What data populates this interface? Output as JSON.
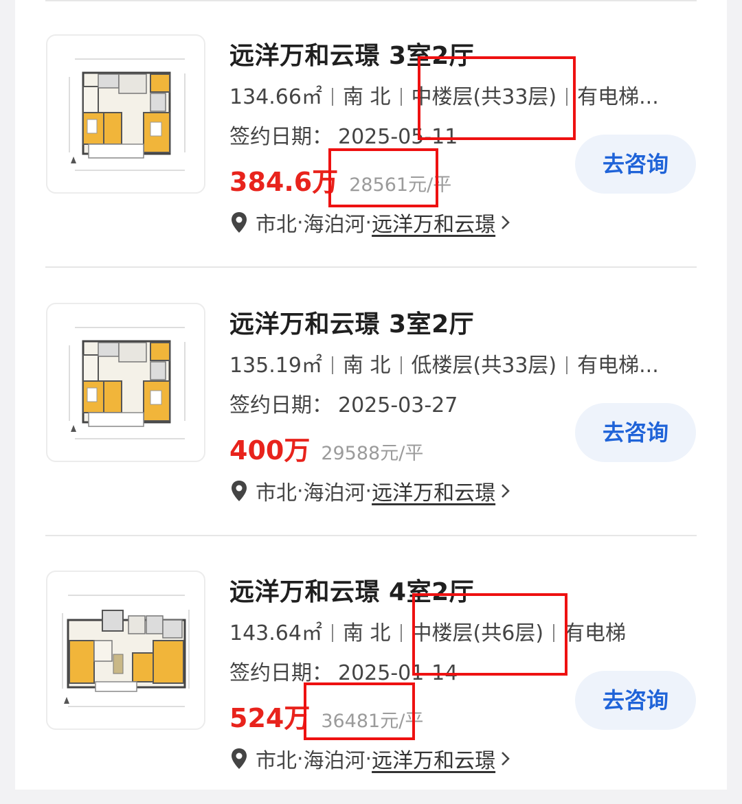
{
  "consult_label": "去咨询",
  "colors": {
    "price": "#e8231c",
    "button_text": "#1f63d8",
    "button_bg": "#eef3fb",
    "highlight": "#ee1111"
  },
  "listings": [
    {
      "title": "远洋万和云璟 3室2厅",
      "area": "134.66㎡",
      "orientation": "南 北",
      "floor": "中楼层(共33层)",
      "elevator": "有电梯...",
      "sign_date_label": "签约日期：",
      "sign_date": "2025-05-11",
      "price": "384.6万",
      "unit_price": "28561元/平",
      "district": "市北",
      "area_name": "海泊河",
      "community": "远洋万和云璟"
    },
    {
      "title": "远洋万和云璟 3室2厅",
      "area": "135.19㎡",
      "orientation": "南 北",
      "floor": "低楼层(共33层)",
      "elevator": "有电梯...",
      "sign_date_label": "签约日期：",
      "sign_date": "2025-03-27",
      "price": "400万",
      "unit_price": "29588元/平",
      "district": "市北",
      "area_name": "海泊河",
      "community": "远洋万和云璟"
    },
    {
      "title": "远洋万和云璟 4室2厅",
      "area": "143.64㎡",
      "orientation": "南 北",
      "floor": "中楼层(共6层)",
      "elevator": "有电梯",
      "sign_date_label": "签约日期：",
      "sign_date": "2025-01-14",
      "price": "524万",
      "unit_price": "36481元/平",
      "district": "市北",
      "area_name": "海泊河",
      "community": "远洋万和云璟"
    }
  ]
}
